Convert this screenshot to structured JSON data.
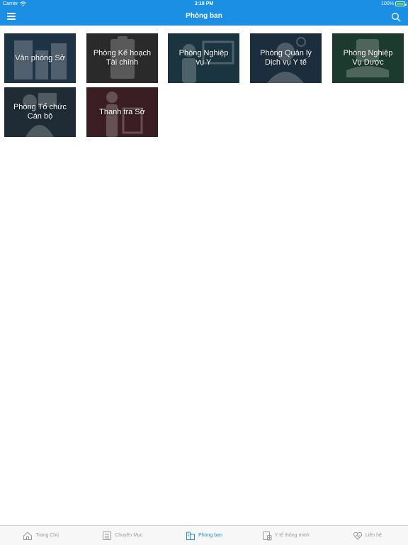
{
  "status_bar": {
    "carrier": "Carrier",
    "time": "3:18 PM",
    "battery": "100%"
  },
  "nav": {
    "title": "Phòng ban",
    "menu_icon": "hamburger-menu-icon",
    "search_icon": "search-icon"
  },
  "departments": [
    {
      "line1": "Văn phòng Sở",
      "line2": "",
      "color": "#1e3346",
      "icon": "building-icon"
    },
    {
      "line1": "Phòng Kế hoạch",
      "line2": "Tài chính",
      "color": "#2a2a2a",
      "icon": "clipboard-icon"
    },
    {
      "line1": "Phòng Nghiệp",
      "line2": "vụ Y",
      "color": "#1b3540",
      "icon": "presenter-icon"
    },
    {
      "line1": "Phòng Quản lý",
      "line2": "Dịch vụ Y tế",
      "color": "#1c2e3e",
      "icon": "nurse-icon"
    },
    {
      "line1": "Phòng Nghiệp",
      "line2": "Vụ Dược",
      "color": "#1c3a2e",
      "icon": "pharmacy-icon"
    },
    {
      "line1": "Phòng Tổ chức",
      "line2": "Cán bộ",
      "color": "#1f2b35",
      "icon": "staff-icon"
    },
    {
      "line1": "Thanh tra Sở",
      "line2": "",
      "color": "#3a1e24",
      "icon": "inspector-icon"
    }
  ],
  "tabs": [
    {
      "label": "Trang Chủ",
      "icon": "home-icon",
      "active": false
    },
    {
      "label": "Chuyên Mục",
      "icon": "list-icon",
      "active": false
    },
    {
      "label": "Phòng ban",
      "icon": "department-icon",
      "active": true
    },
    {
      "label": "Y tế thông minh",
      "icon": "smart-health-icon",
      "active": false
    },
    {
      "label": "Liên hệ",
      "icon": "contact-icon",
      "active": false
    }
  ],
  "colors": {
    "primary": "#1a8fe3",
    "tab_inactive": "#9a9a9a",
    "tab_bar_bg": "#f7f7f7"
  }
}
